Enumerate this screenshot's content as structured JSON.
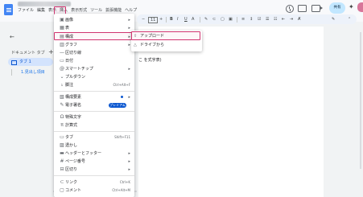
{
  "colors": {
    "accent": "#0b57d0",
    "highlight": "#d03470",
    "share": "#c2e7ff",
    "doc_blue": "#4285f4"
  },
  "menubar": {
    "items": [
      "ファイル",
      "編集",
      "表示",
      "挿入",
      "表示形式",
      "ツール",
      "拡張機能",
      "ヘルプ"
    ]
  },
  "header": {
    "share_label": "共有",
    "icons": [
      "history-icon",
      "comment-icon",
      "meet-icon",
      "gemini-icon"
    ]
  },
  "toolbar": {
    "zoom_minus": "−",
    "font_size": "11",
    "zoom_plus": "+",
    "bold": "B",
    "italic": "I",
    "underline": "U",
    "text_color": "A",
    "more": "⋮"
  },
  "left_panel": {
    "back_icon": "←",
    "tabs_title": "ドキュメント タブ",
    "add_icon": "+",
    "tab_label": "タブ 1",
    "heading_label": "1.見出し項目"
  },
  "document": {
    "visible_text": "こ を式字表) "
  },
  "insert_menu": {
    "items": [
      {
        "icon": "image-icon",
        "glyph": "▣",
        "label": "画像",
        "arrow": "▸"
      },
      {
        "icon": "table-icon",
        "glyph": "▦",
        "label": "表",
        "arrow": "▸"
      },
      {
        "icon": "building-blocks-icon",
        "glyph": "▤",
        "label": "構成",
        "arrow": "▸"
      },
      {
        "icon": "chart-icon",
        "glyph": "▥",
        "label": "グラフ",
        "arrow": "▸"
      },
      {
        "icon": "horizontal-line-icon",
        "glyph": "—",
        "label": "区切り線"
      },
      {
        "icon": "date-icon",
        "glyph": "▭",
        "label": "日付"
      },
      {
        "icon": "smart-chip-icon",
        "glyph": "@",
        "label": "スマートチップ",
        "arrow": "▸"
      },
      {
        "icon": "dropdown-icon",
        "glyph": "⌄",
        "label": "プルダウン"
      },
      {
        "icon": "footnote-icon",
        "glyph": "₁",
        "label": "脚注",
        "shortcut": "Ctrl+Alt+F"
      },
      {
        "icon": "building-blocks2-icon",
        "glyph": "▧",
        "label": "構成要素",
        "arrow": "▸",
        "badge": ""
      },
      {
        "icon": "e-signature-icon",
        "glyph": "✎",
        "label": "電子署名",
        "premium": "プレミアム"
      },
      {
        "icon": "special-chars-icon",
        "glyph": "Ω",
        "label": "特殊文字"
      },
      {
        "icon": "equation-icon",
        "glyph": "π",
        "label": "計算式"
      },
      {
        "icon": "tab-icon",
        "glyph": "▭",
        "label": "タブ",
        "shortcut": "Shift+F11"
      },
      {
        "icon": "watermark-icon",
        "glyph": "▨",
        "label": "透かし"
      },
      {
        "icon": "header-footer-icon",
        "glyph": "▬",
        "label": "ヘッダーとフッター",
        "arrow": "▸"
      },
      {
        "icon": "page-numbers-icon",
        "glyph": "#",
        "label": "ページ番号",
        "arrow": "▸"
      },
      {
        "icon": "break-icon",
        "glyph": "⊟",
        "label": "区切り",
        "arrow": "▸"
      },
      {
        "icon": "link-icon",
        "glyph": "⊂",
        "label": "リンク",
        "shortcut": "Ctrl+K"
      },
      {
        "icon": "comment-add-icon",
        "glyph": "▢",
        "label": "コメント",
        "shortcut": "Ctrl+Alt+M"
      }
    ]
  },
  "table_submenu": {
    "items": [
      {
        "icon": "upload-icon",
        "glyph": "⇧",
        "label": "アップロード"
      },
      {
        "icon": "drive-icon",
        "glyph": "△",
        "label": "ドライブから"
      }
    ]
  }
}
